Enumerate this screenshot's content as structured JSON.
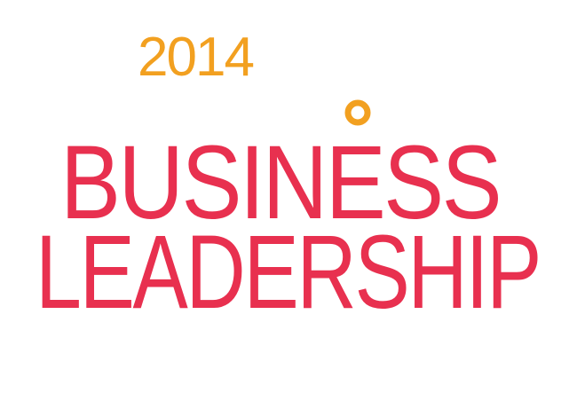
{
  "logo": {
    "year": "2014",
    "line1": "BUSINESS",
    "line2": "LEADERSHIP"
  },
  "colors": {
    "year": "#F2A020",
    "text": "#E8304F",
    "accent_ring": "#F2A020",
    "background": "#FFFFFF"
  },
  "icons": {
    "accent": "circle-ring-icon"
  }
}
